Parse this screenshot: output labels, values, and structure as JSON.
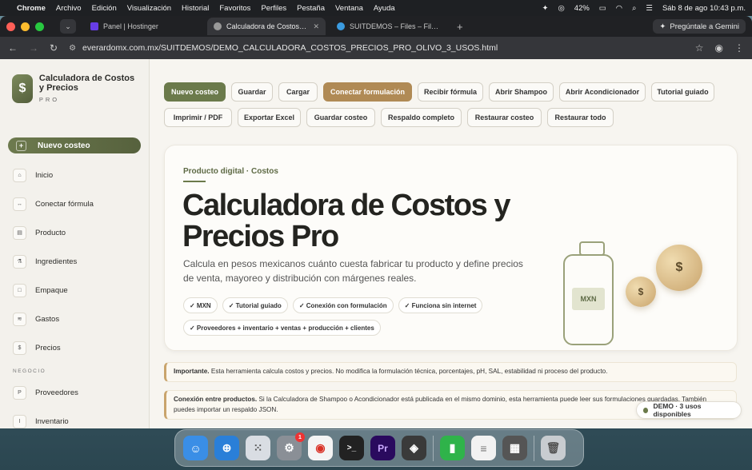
{
  "menubar": {
    "app": "Chrome",
    "items": [
      "Archivo",
      "Edición",
      "Visualización",
      "Historial",
      "Favoritos",
      "Perfiles",
      "Pestaña",
      "Ventana",
      "Ayuda"
    ],
    "battery": "42%",
    "datetime": "Sáb 8 de ago  10:43 p.m."
  },
  "tabs": [
    {
      "title": "Panel | Hostinger",
      "active": false
    },
    {
      "title": "Calculadora de Costos y Prec",
      "active": true
    },
    {
      "title": "SUITDEMOS – Files – File Brow",
      "active": false
    }
  ],
  "gemini_label": "Pregúntale a Gemini",
  "address_bar": "everardomx.com.mx/SUITDEMOS/DEMO_CALCULADORA_COSTOS_PRECIOS_PRO_OLIVO_3_USOS.html",
  "brand": {
    "logo": "$",
    "title": "Calculadora de Costos y Precios",
    "subtitle": "PRO"
  },
  "new_cost_label": "Nuevo costeo",
  "nav": [
    {
      "label": "Inicio",
      "icon": "⌂"
    },
    {
      "label": "Conectar fórmula",
      "icon": "↔"
    },
    {
      "label": "Producto",
      "icon": "▤"
    },
    {
      "label": "Ingredientes",
      "icon": "⚗"
    },
    {
      "label": "Empaque",
      "icon": "□"
    },
    {
      "label": "Gastos",
      "icon": "≋"
    },
    {
      "label": "Precios",
      "icon": "$"
    }
  ],
  "nav_section": "NEGOCIO",
  "nav_business": [
    {
      "label": "Proveedores",
      "icon": "P"
    },
    {
      "label": "Inventario",
      "icon": "I"
    }
  ],
  "toolbar_row1": [
    "Nuevo costeo",
    "Guardar",
    "Cargar",
    "Conectar formulación",
    "Recibir fórmula",
    "Abrir Shampoo",
    "Abrir Acondicionador",
    "Tutorial guiado"
  ],
  "toolbar_row2": [
    "Imprimir / PDF",
    "Exportar Excel",
    "Guardar costeo",
    "Respaldo completo",
    "Restaurar costeo",
    "Restaurar todo"
  ],
  "hero": {
    "kicker": "Producto digital · Costos",
    "title": "Calculadora de Costos y Precios Pro",
    "description": "Calcula en pesos mexicanos cuánto cuesta fabricar tu producto y define precios de venta, mayoreo y distribución con márgenes reales.",
    "chips": [
      "✓ MXN",
      "✓ Tutorial guiado",
      "✓ Conexión con formulación",
      "✓ Funciona sin internet",
      "✓ Proveedores + inventario + ventas + producción + clientes"
    ],
    "bottle_label": "MXN",
    "coin_symbol": "$"
  },
  "notes": [
    {
      "bold": "Importante.",
      "text": " Esta herramienta calcula costos y precios. No modifica la formulación técnica, porcentajes, pH, SAL, estabilidad ni proceso del producto."
    },
    {
      "bold": "Conexión entre productos.",
      "text": " Si la Calculadora de Shampoo o Acondicionador está publicada en el mismo dominio, esta herramienta puede leer sus formulaciones guardadas. También puedes importar un respaldo JSON."
    }
  ],
  "demo_badge": "DEMO · 3 usos disponibles",
  "dock": [
    {
      "name": "finder-icon",
      "color": "#3a8ee6",
      "glyph": "☺"
    },
    {
      "name": "safari-icon",
      "color": "#2a7fd8",
      "glyph": "⊕"
    },
    {
      "name": "launchpad-icon",
      "color": "#d9dde3",
      "glyph": "⁙"
    },
    {
      "name": "system-settings-icon",
      "color": "#8a8f96",
      "glyph": "⚙",
      "badge": "1"
    },
    {
      "name": "chrome-icon",
      "color": "#f4f4f4",
      "glyph": "◉"
    },
    {
      "name": "terminal-icon",
      "color": "#222",
      "glyph": ">_"
    },
    {
      "name": "premiere-icon",
      "color": "#2a0a5e",
      "glyph": "Pr"
    },
    {
      "name": "cube-app-icon",
      "color": "#3a3a3a",
      "glyph": "◈"
    },
    {
      "name": "numbers-icon",
      "color": "#2fb34a",
      "glyph": "▮"
    },
    {
      "name": "notes-list-icon",
      "color": "#f2f2f2",
      "glyph": "≡"
    },
    {
      "name": "calculator-icon",
      "color": "#555",
      "glyph": "▦"
    },
    {
      "name": "trash-icon",
      "color": "#c8ccd0",
      "glyph": "🗑"
    }
  ]
}
